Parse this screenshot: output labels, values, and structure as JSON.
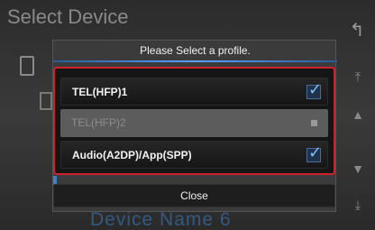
{
  "background": {
    "title": "Select Device",
    "partial_device_text": "Device Name 6"
  },
  "dialog": {
    "title": "Please Select a profile.",
    "options": [
      {
        "label": "TEL(HFP)1",
        "state": "checked",
        "enabled": true
      },
      {
        "label": "TEL(HFP)2",
        "state": "unavailable",
        "enabled": false
      },
      {
        "label": "Audio(A2DP)/App(SPP)",
        "state": "checked",
        "enabled": true
      }
    ],
    "close_label": "Close"
  },
  "icons": {
    "back": "back-arrow-icon",
    "scroll_top": "scroll-top-icon",
    "scroll_up": "scroll-up-icon",
    "scroll_down": "scroll-down-icon",
    "scroll_bottom": "scroll-bottom-icon",
    "check": "checkmark-icon"
  },
  "colors": {
    "highlight_border": "#d0202a",
    "accent": "#3d7fc8"
  }
}
